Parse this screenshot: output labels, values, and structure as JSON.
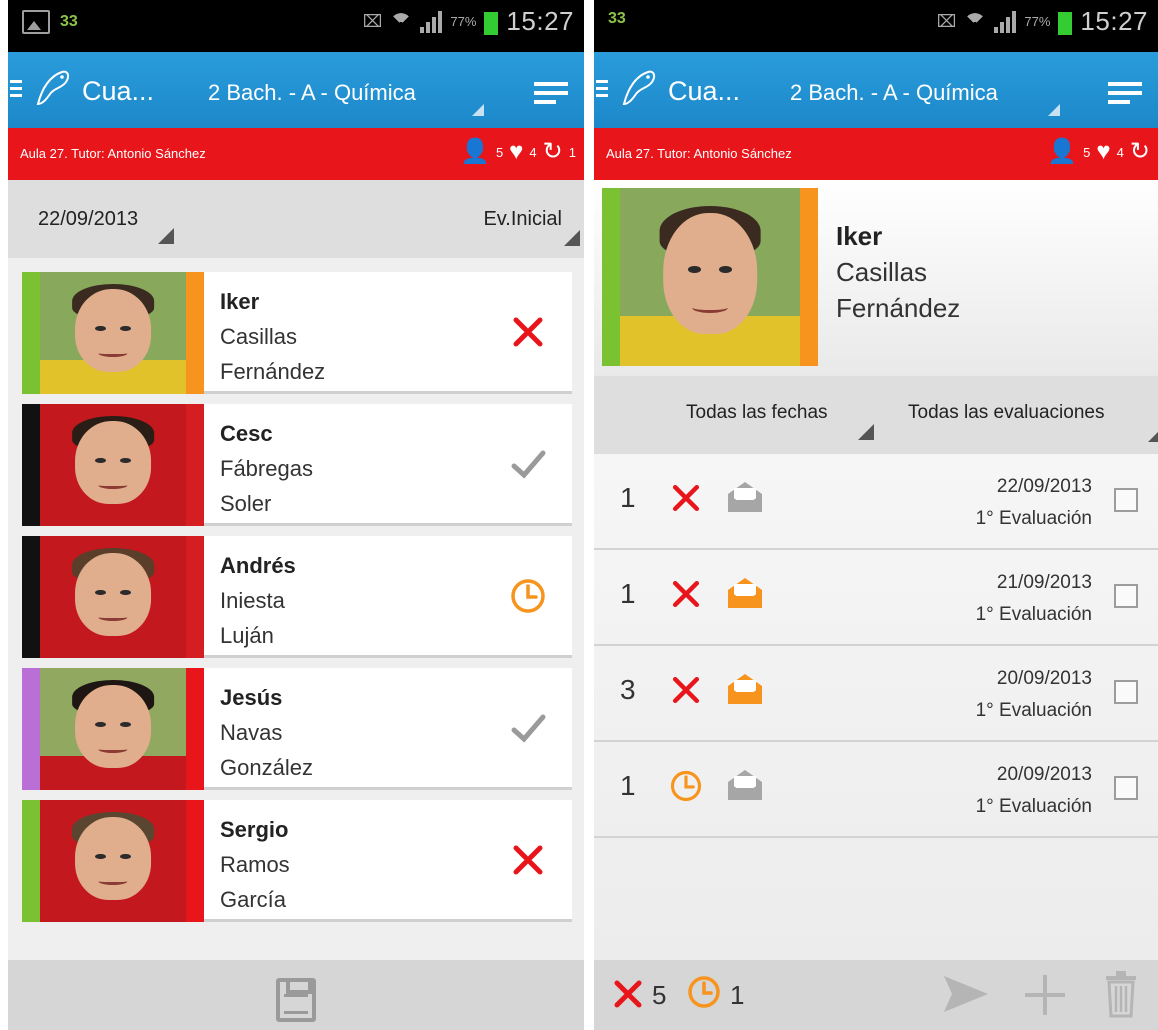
{
  "status_bar": {
    "notification": "33",
    "battery": "77%",
    "time": "15:27"
  },
  "action_bar": {
    "title": "Cua...",
    "class_name": "2 Bach. - A - Química"
  },
  "info_bar": {
    "text": "Aula 27. Tutor: Antonio Sánchez",
    "students_count": "5",
    "hearts_count": "4",
    "refresh_count": "1"
  },
  "left": {
    "filter": {
      "date": "22/09/2013",
      "evaluation": "Ev.Inicial"
    },
    "students": [
      {
        "first": "Iker",
        "last1": "Casillas",
        "last2": "Fernández",
        "status": "absent",
        "stripe_left": "#7ac231",
        "stripe_right": "#f7941e"
      },
      {
        "first": "Cesc",
        "last1": "Fábregas",
        "last2": "Soler",
        "status": "present",
        "stripe_left": "#111111",
        "stripe_right": "#d41e22"
      },
      {
        "first": "Andrés",
        "last1": "Iniesta",
        "last2": "Luján",
        "status": "late",
        "stripe_left": "#111111",
        "stripe_right": "#d41e22"
      },
      {
        "first": "Jesús",
        "last1": "Navas",
        "last2": "González",
        "status": "present",
        "stripe_left": "#b96fd6",
        "stripe_right": "#e8151b"
      },
      {
        "first": "Sergio",
        "last1": "Ramos",
        "last2": "García",
        "status": "absent",
        "stripe_left": "#7ac231",
        "stripe_right": "#e8151b"
      }
    ]
  },
  "right": {
    "student": {
      "first": "Iker",
      "last1": "Casillas",
      "last2": "Fernández"
    },
    "filter": {
      "dates": "Todas las fechas",
      "evaluations": "Todas las evaluaciones"
    },
    "records": [
      {
        "count": "1",
        "status": "absent",
        "envelope": "gray",
        "date": "22/09/2013",
        "evaluation": "1° Evaluación"
      },
      {
        "count": "1",
        "status": "absent",
        "envelope": "orange",
        "date": "21/09/2013",
        "evaluation": "1° Evaluación"
      },
      {
        "count": "3",
        "status": "absent",
        "envelope": "orange",
        "date": "20/09/2013",
        "evaluation": "1° Evaluación"
      },
      {
        "count": "1",
        "status": "late",
        "envelope": "gray",
        "date": "20/09/2013",
        "evaluation": "1° Evaluación"
      }
    ],
    "totals": {
      "absent": "5",
      "late": "1"
    }
  },
  "colors": {
    "action_bar": "#1c88c9",
    "info_bar": "#e8151b",
    "absent": "#e8151b",
    "late": "#f7941e",
    "present": "#9a9a9a"
  }
}
